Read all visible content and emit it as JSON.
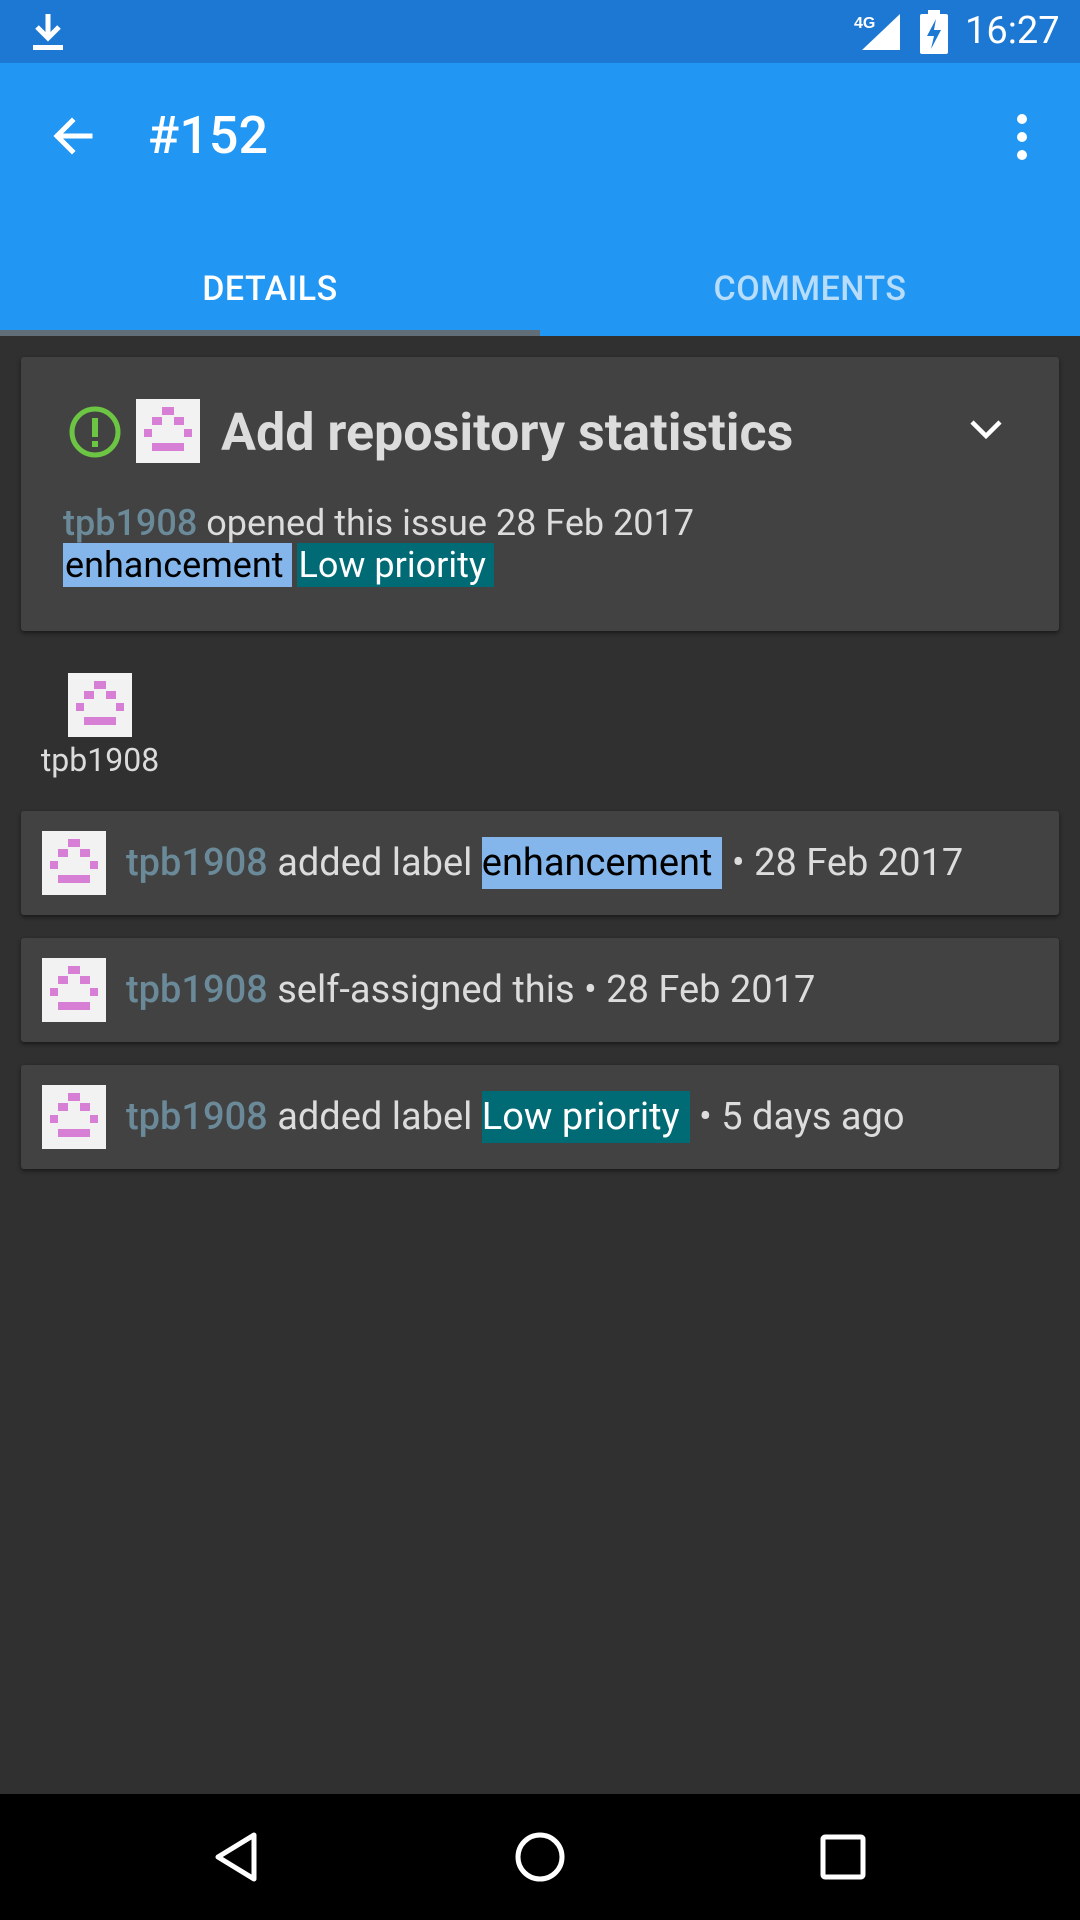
{
  "status_bar": {
    "time": "16:27",
    "network": "4G",
    "icons": [
      "download-icon",
      "signal-icon",
      "battery-charging-icon"
    ]
  },
  "app_bar": {
    "title": "#152",
    "back_icon": "arrow-back-icon",
    "menu_icon": "more-vert-icon"
  },
  "tabs": [
    {
      "label": "DETAILS",
      "selected": true
    },
    {
      "label": "COMMENTS",
      "selected": false
    }
  ],
  "issue": {
    "status_icon": "issue-open-icon",
    "title": "Add repository statistics",
    "author": "tpb1908",
    "opened_text": " opened this issue 28 Feb 2017",
    "labels": [
      {
        "name": "enhancement",
        "color": "#84b6eb"
      },
      {
        "name": "Low priority",
        "color": "#006b75"
      }
    ]
  },
  "assignee": {
    "name": "tpb1908"
  },
  "events": [
    {
      "user": "tpb1908",
      "action": " added label ",
      "label": "enhancement",
      "time": " • 28 Feb 2017"
    },
    {
      "user": "tpb1908",
      "action": " self-assigned this • 28 Feb 2017"
    },
    {
      "user": "tpb1908",
      "action": " added label ",
      "label": "Low priority",
      "time": " • 5 days ago"
    }
  ],
  "colors": {
    "status_bar": "#1c78d2",
    "app_bar": "#2196f3",
    "background": "#303030",
    "card": "#424242",
    "open_issue": "#6cc644",
    "user_link": "#6b8a99"
  }
}
